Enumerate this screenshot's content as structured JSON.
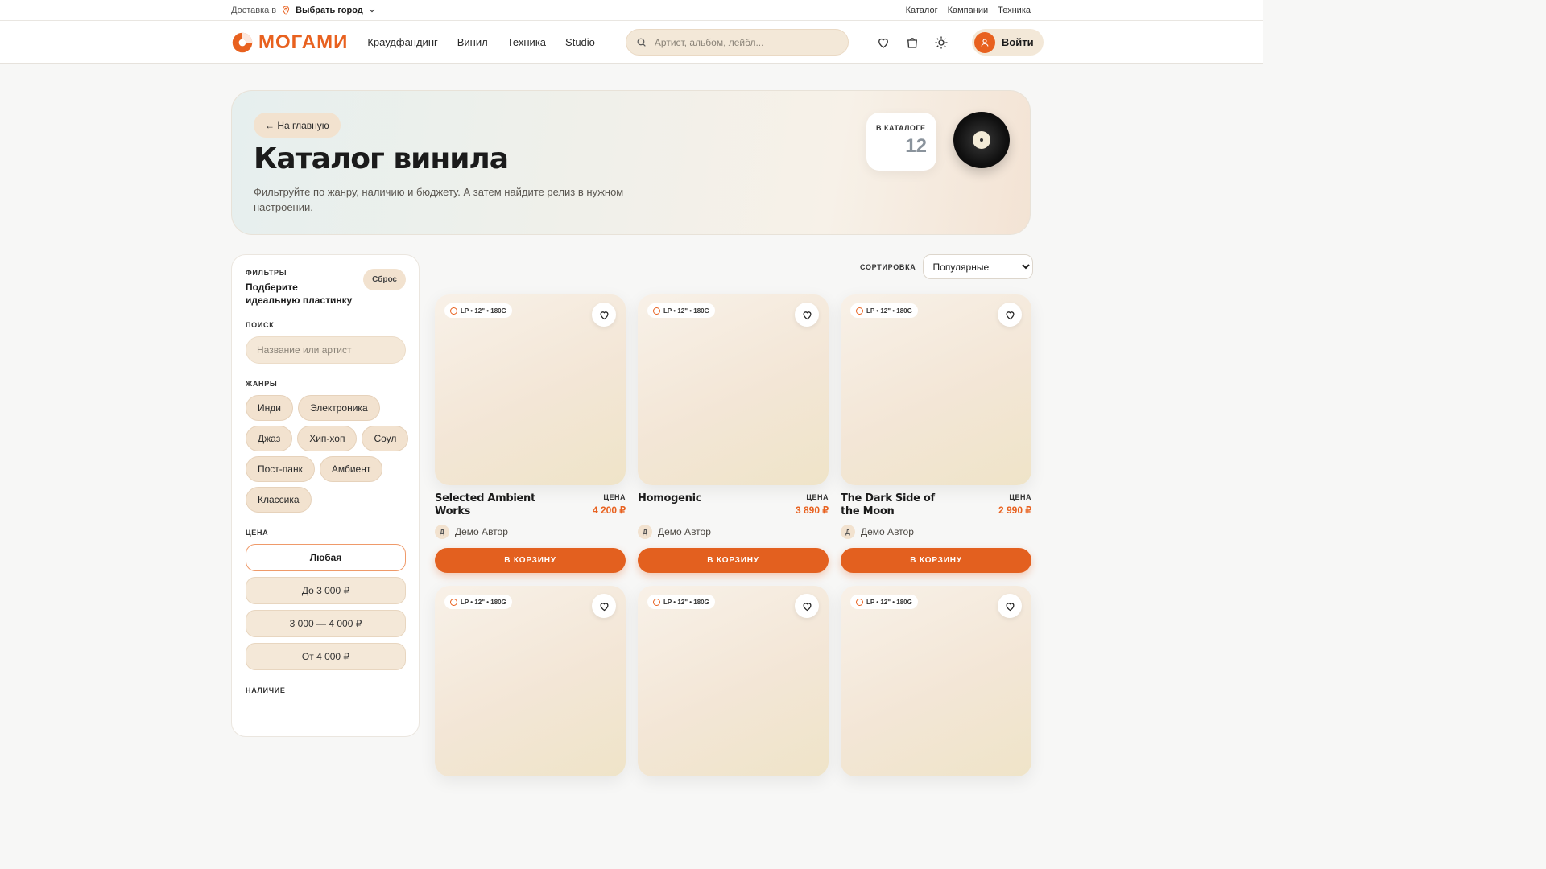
{
  "topbar": {
    "delivery_label": "Доставка в",
    "city": "Выбрать город",
    "links": [
      "Каталог",
      "Кампании",
      "Техника"
    ]
  },
  "header": {
    "logo": "МОГАМИ",
    "nav": [
      "Краудфандинг",
      "Винил",
      "Техника",
      "Studio"
    ],
    "search_placeholder": "Артист, альбом, лейбл...",
    "icons": [
      "heart-icon",
      "cart-icon",
      "sun-icon"
    ],
    "login": "Войти"
  },
  "hero": {
    "back": "← На главную",
    "title": "Каталог винила",
    "description": "Фильтруйте по жанру, наличию и бюджету. А затем найдите релиз в нужном настроении.",
    "count_label": "В КАТАЛОГЕ",
    "count": "12"
  },
  "filters": {
    "caption": "ФИЛЬТРЫ",
    "subtitle": "Подберите идеальную пластинку",
    "reset": "Сброс",
    "search_caption": "ПОИСК",
    "search_placeholder": "Название или артист",
    "genres_caption": "ЖАНРЫ",
    "genres": [
      "Инди",
      "Электроника",
      "Джаз",
      "Хип-хоп",
      "Соул",
      "Пост-панк",
      "Амбиент",
      "Классика"
    ],
    "price_caption": "ЦЕНА",
    "prices": [
      "Любая",
      "До 3 000 ₽",
      "3 000 — 4 000 ₽",
      "От 4 000 ₽"
    ],
    "price_active": "Любая",
    "stock_caption": "НАЛИЧИЕ"
  },
  "sort": {
    "caption": "СОРТИРОВКА",
    "selected": "Популярные"
  },
  "products": [
    {
      "tag": "LP • 12\" • 180G",
      "title": "Selected Ambient Works",
      "price_label": "ЦЕНА",
      "price": "4 200 ₽",
      "author_initial": "Д",
      "author": "Демо Автор",
      "cart": "В КОРЗИНУ"
    },
    {
      "tag": "LP • 12\" • 180G",
      "title": "Homogenic",
      "price_label": "ЦЕНА",
      "price": "3 890 ₽",
      "author_initial": "Д",
      "author": "Демо Автор",
      "cart": "В КОРЗИНУ"
    },
    {
      "tag": "LP • 12\" • 180G",
      "title": "The Dark Side of the Moon",
      "price_label": "ЦЕНА",
      "price": "2 990 ₽",
      "author_initial": "Д",
      "author": "Демо Автор",
      "cart": "В КОРЗИНУ"
    },
    {
      "tag": "LP • 12\" • 180G"
    },
    {
      "tag": "LP • 12\" • 180G"
    },
    {
      "tag": "LP • 12\" • 180G"
    }
  ],
  "colors": {
    "accent": "#e3601f",
    "beige": "#f2e2cf"
  }
}
